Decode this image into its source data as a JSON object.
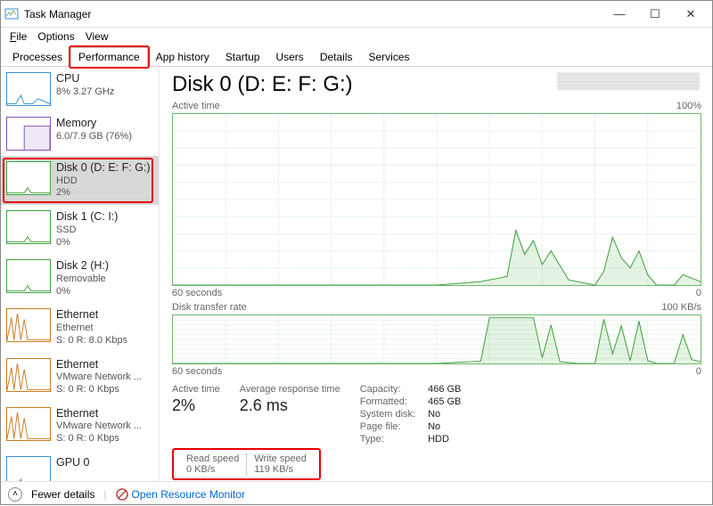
{
  "window": {
    "title": "Task Manager"
  },
  "menu": {
    "file": "File",
    "options": "Options",
    "view": "View"
  },
  "tabs": [
    "Processes",
    "Performance",
    "App history",
    "Startup",
    "Users",
    "Details",
    "Services"
  ],
  "active_tab": 1,
  "sidebar": {
    "items": [
      {
        "name": "CPU",
        "line1": "8%  3.27 GHz",
        "line2": "",
        "color": "#3b8fd4"
      },
      {
        "name": "Memory",
        "line1": "6.0/7.9 GB (76%)",
        "line2": "",
        "color": "#8a4fbf"
      },
      {
        "name": "Disk 0 (D: E: F: G:)",
        "line1": "HDD",
        "line2": "2%",
        "color": "#3fa23f",
        "selected": true,
        "highlight": true
      },
      {
        "name": "Disk 1 (C: I:)",
        "line1": "SSD",
        "line2": "0%",
        "color": "#3fa23f"
      },
      {
        "name": "Disk 2 (H:)",
        "line1": "Removable",
        "line2": "0%",
        "color": "#3fa23f"
      },
      {
        "name": "Ethernet",
        "line1": "Ethernet",
        "line2": "S: 0 R: 8.0 Kbps",
        "color": "#c77a1f"
      },
      {
        "name": "Ethernet",
        "line1": "VMware Network ...",
        "line2": "S: 0 R: 0 Kbps",
        "color": "#c77a1f"
      },
      {
        "name": "Ethernet",
        "line1": "VMware Network ...",
        "line2": "S: 0 R: 0 Kbps",
        "color": "#c77a1f"
      },
      {
        "name": "GPU 0",
        "line1": "",
        "line2": "",
        "color": "#3b8fd4"
      }
    ]
  },
  "detail": {
    "title": "Disk 0 (D: E: F: G:)",
    "chart1": {
      "label": "Active time",
      "max": "100%",
      "xleft": "60 seconds",
      "xright": "0"
    },
    "chart2": {
      "label": "Disk transfer rate",
      "max": "100 KB/s",
      "xleft": "60 seconds",
      "xright": "0"
    },
    "stats": {
      "active_label": "Active time",
      "active_value": "2%",
      "avg_label": "Average response time",
      "avg_value": "2.6 ms",
      "read_label": "Read speed",
      "read_value": "0 KB/s",
      "write_label": "Write speed",
      "write_value": "119 KB/s"
    },
    "info": [
      [
        "Capacity:",
        "466 GB"
      ],
      [
        "Formatted:",
        "465 GB"
      ],
      [
        "System disk:",
        "No"
      ],
      [
        "Page file:",
        "No"
      ],
      [
        "Type:",
        "HDD"
      ]
    ]
  },
  "footer": {
    "fewer": "Fewer details",
    "orm": "Open Resource Monitor"
  },
  "chart_data": [
    {
      "type": "area",
      "title": "Active time",
      "ylabel": "%",
      "ylim": [
        0,
        100
      ],
      "xlabel": "seconds ago",
      "xlim": [
        60,
        0
      ],
      "x": [
        60,
        50,
        40,
        30,
        25,
        22,
        21,
        20,
        19,
        18,
        17,
        15,
        12,
        11,
        10,
        9,
        8,
        7,
        6,
        5,
        3,
        2,
        1,
        0
      ],
      "values": [
        0,
        0,
        0,
        0,
        2,
        5,
        32,
        18,
        26,
        12,
        20,
        3,
        0,
        8,
        28,
        16,
        10,
        20,
        6,
        0,
        0,
        6,
        4,
        2
      ]
    },
    {
      "type": "area",
      "title": "Disk transfer rate",
      "ylabel": "KB/s",
      "ylim": [
        0,
        100
      ],
      "xlabel": "seconds ago",
      "xlim": [
        60,
        0
      ],
      "x": [
        60,
        30,
        25,
        24,
        23,
        22,
        21,
        20,
        19,
        18,
        17,
        16,
        14,
        12,
        11,
        10,
        9,
        8,
        7,
        6,
        5,
        3,
        2,
        1,
        0
      ],
      "values": [
        0,
        0,
        5,
        95,
        95,
        95,
        95,
        95,
        95,
        12,
        80,
        4,
        0,
        0,
        92,
        20,
        78,
        6,
        88,
        6,
        0,
        0,
        60,
        8,
        4
      ]
    }
  ]
}
